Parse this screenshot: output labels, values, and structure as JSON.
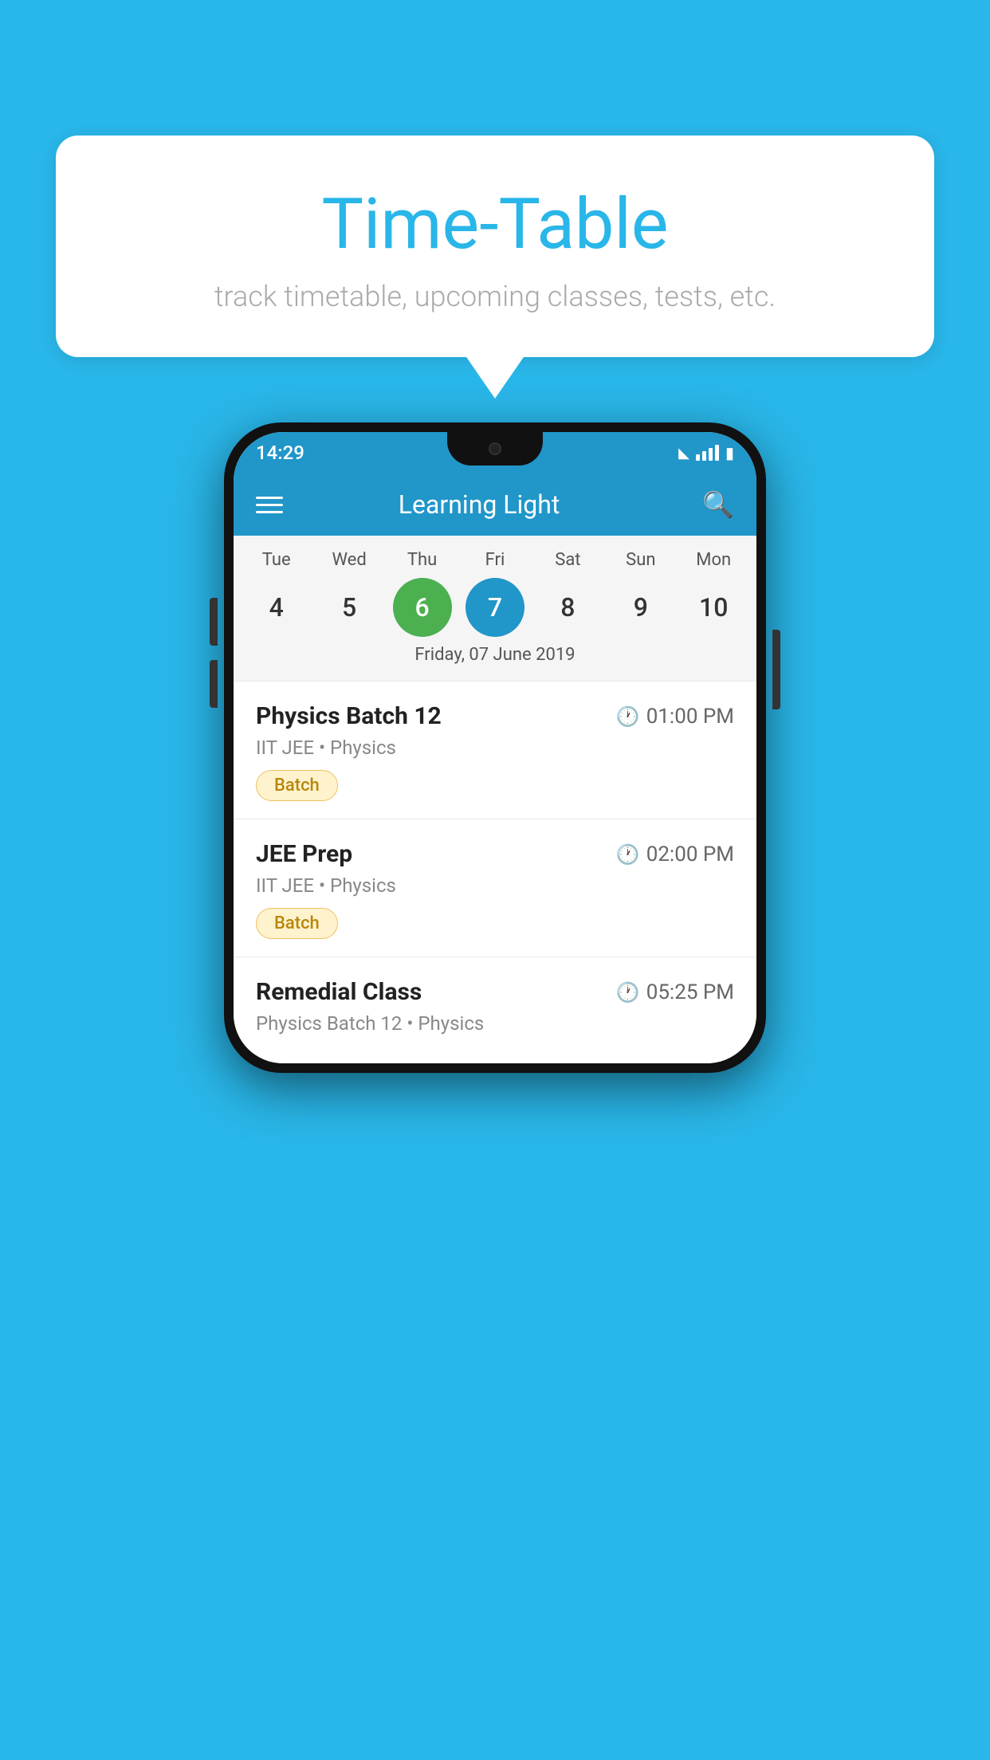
{
  "background": {
    "color": "#29b6e8"
  },
  "speech_bubble": {
    "title": "Time-Table",
    "subtitle": "track timetable, upcoming classes, tests, etc."
  },
  "phone": {
    "status_bar": {
      "time": "14:29"
    },
    "app_header": {
      "title": "Learning Light"
    },
    "calendar": {
      "day_names": [
        "Tue",
        "Wed",
        "Thu",
        "Fri",
        "Sat",
        "Sun",
        "Mon"
      ],
      "day_numbers": [
        "4",
        "5",
        "6",
        "7",
        "8",
        "9",
        "10"
      ],
      "today_green_index": 2,
      "today_blue_index": 3,
      "selected_date": "Friday, 07 June 2019"
    },
    "schedule_items": [
      {
        "title": "Physics Batch 12",
        "time": "01:00 PM",
        "sub": "IIT JEE • Physics",
        "badge": "Batch"
      },
      {
        "title": "JEE Prep",
        "time": "02:00 PM",
        "sub": "IIT JEE • Physics",
        "badge": "Batch"
      },
      {
        "title": "Remedial Class",
        "time": "05:25 PM",
        "sub": "Physics Batch 12 • Physics",
        "badge": ""
      }
    ]
  }
}
